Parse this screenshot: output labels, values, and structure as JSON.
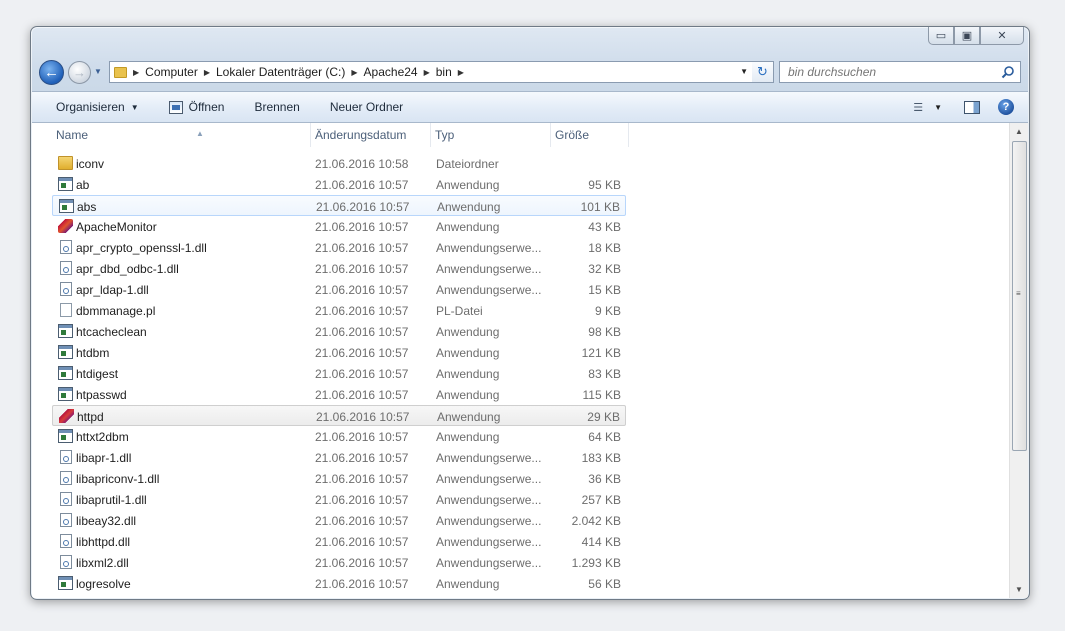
{
  "window": {
    "caption_buttons": {
      "minimize": "▭",
      "maximize": "▣",
      "close": "✕"
    }
  },
  "address": {
    "breadcrumbs": [
      "Computer",
      "Lokaler Datenträger (C:)",
      "Apache24",
      "bin"
    ],
    "search_placeholder": "bin durchsuchen"
  },
  "toolbar": {
    "organize_label": "Organisieren",
    "open_label": "Öffnen",
    "burn_label": "Brennen",
    "new_folder_label": "Neuer Ordner"
  },
  "columns": {
    "name": "Name",
    "date": "Änderungsdatum",
    "type": "Typ",
    "size": "Größe"
  },
  "files": [
    {
      "name": "iconv",
      "date": "21.06.2016 10:58",
      "type": "Dateiordner",
      "size": "",
      "icon": "folder"
    },
    {
      "name": "ab",
      "date": "21.06.2016 10:57",
      "type": "Anwendung",
      "size": "95 KB",
      "icon": "app"
    },
    {
      "name": "abs",
      "date": "21.06.2016 10:57",
      "type": "Anwendung",
      "size": "101 KB",
      "icon": "app",
      "state": "hover"
    },
    {
      "name": "ApacheMonitor",
      "date": "21.06.2016 10:57",
      "type": "Anwendung",
      "size": "43 KB",
      "icon": "monitor"
    },
    {
      "name": "apr_crypto_openssl-1.dll",
      "date": "21.06.2016 10:57",
      "type": "Anwendungserwe...",
      "size": "18 KB",
      "icon": "dll"
    },
    {
      "name": "apr_dbd_odbc-1.dll",
      "date": "21.06.2016 10:57",
      "type": "Anwendungserwe...",
      "size": "32 KB",
      "icon": "dll"
    },
    {
      "name": "apr_ldap-1.dll",
      "date": "21.06.2016 10:57",
      "type": "Anwendungserwe...",
      "size": "15 KB",
      "icon": "dll"
    },
    {
      "name": "dbmmanage.pl",
      "date": "21.06.2016 10:57",
      "type": "PL-Datei",
      "size": "9 KB",
      "icon": "file"
    },
    {
      "name": "htcacheclean",
      "date": "21.06.2016 10:57",
      "type": "Anwendung",
      "size": "98 KB",
      "icon": "app"
    },
    {
      "name": "htdbm",
      "date": "21.06.2016 10:57",
      "type": "Anwendung",
      "size": "121 KB",
      "icon": "app"
    },
    {
      "name": "htdigest",
      "date": "21.06.2016 10:57",
      "type": "Anwendung",
      "size": "83 KB",
      "icon": "app"
    },
    {
      "name": "htpasswd",
      "date": "21.06.2016 10:57",
      "type": "Anwendung",
      "size": "115 KB",
      "icon": "app"
    },
    {
      "name": "httpd",
      "date": "21.06.2016 10:57",
      "type": "Anwendung",
      "size": "29 KB",
      "icon": "feather",
      "state": "selected"
    },
    {
      "name": "httxt2dbm",
      "date": "21.06.2016 10:57",
      "type": "Anwendung",
      "size": "64 KB",
      "icon": "app"
    },
    {
      "name": "libapr-1.dll",
      "date": "21.06.2016 10:57",
      "type": "Anwendungserwe...",
      "size": "183 KB",
      "icon": "dll"
    },
    {
      "name": "libapriconv-1.dll",
      "date": "21.06.2016 10:57",
      "type": "Anwendungserwe...",
      "size": "36 KB",
      "icon": "dll"
    },
    {
      "name": "libaprutil-1.dll",
      "date": "21.06.2016 10:57",
      "type": "Anwendungserwe...",
      "size": "257 KB",
      "icon": "dll"
    },
    {
      "name": "libeay32.dll",
      "date": "21.06.2016 10:57",
      "type": "Anwendungserwe...",
      "size": "2.042 KB",
      "icon": "dll"
    },
    {
      "name": "libhttpd.dll",
      "date": "21.06.2016 10:57",
      "type": "Anwendungserwe...",
      "size": "414 KB",
      "icon": "dll"
    },
    {
      "name": "libxml2.dll",
      "date": "21.06.2016 10:57",
      "type": "Anwendungserwe...",
      "size": "1.293 KB",
      "icon": "dll"
    },
    {
      "name": "logresolve",
      "date": "21.06.2016 10:57",
      "type": "Anwendung",
      "size": "56 KB",
      "icon": "app"
    }
  ]
}
